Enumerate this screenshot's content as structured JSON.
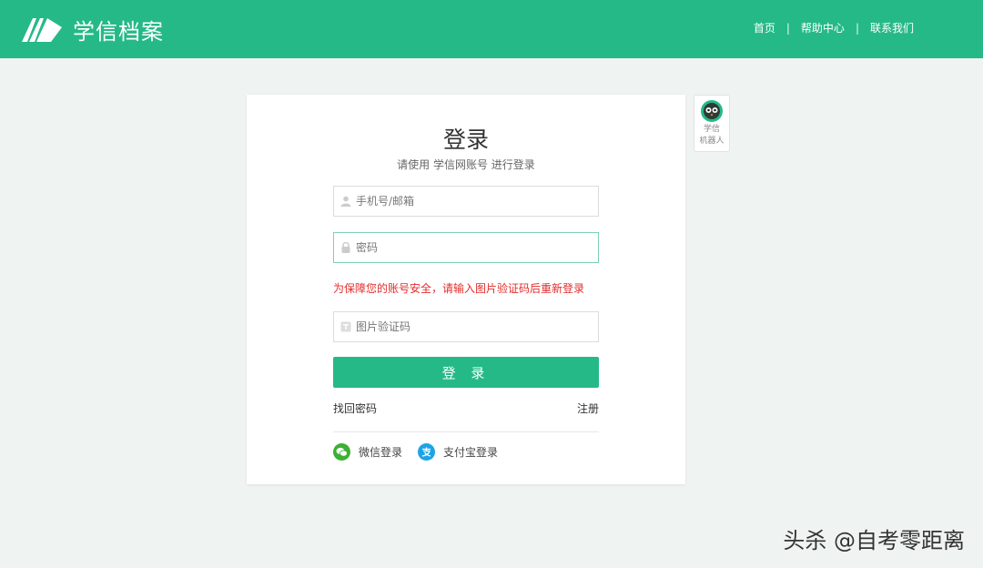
{
  "header": {
    "logo_text": "学信档案",
    "nav": [
      {
        "label": "首页"
      },
      {
        "label": "帮助中心"
      },
      {
        "label": "联系我们"
      }
    ],
    "separator": "|"
  },
  "login": {
    "title": "登录",
    "subtitle": "请使用 学信网账号 进行登录",
    "phone_placeholder": "手机号/邮箱",
    "password_placeholder": "密码",
    "warning": "为保障您的账号安全，请输入图片验证码后重新登录",
    "captcha_placeholder": "图片验证码",
    "submit_label": "登 录",
    "forgot_label": "找回密码",
    "register_label": "注册",
    "wechat_label": "微信登录",
    "alipay_label": "支付宝登录"
  },
  "robot": {
    "line1": "学信",
    "line2": "机器人"
  },
  "watermark": "头杀 @自考零距离",
  "colors": {
    "brand": "#25b987",
    "warning": "#e32c2c",
    "wechat": "#3cb034",
    "alipay": "#1ea4e6"
  }
}
